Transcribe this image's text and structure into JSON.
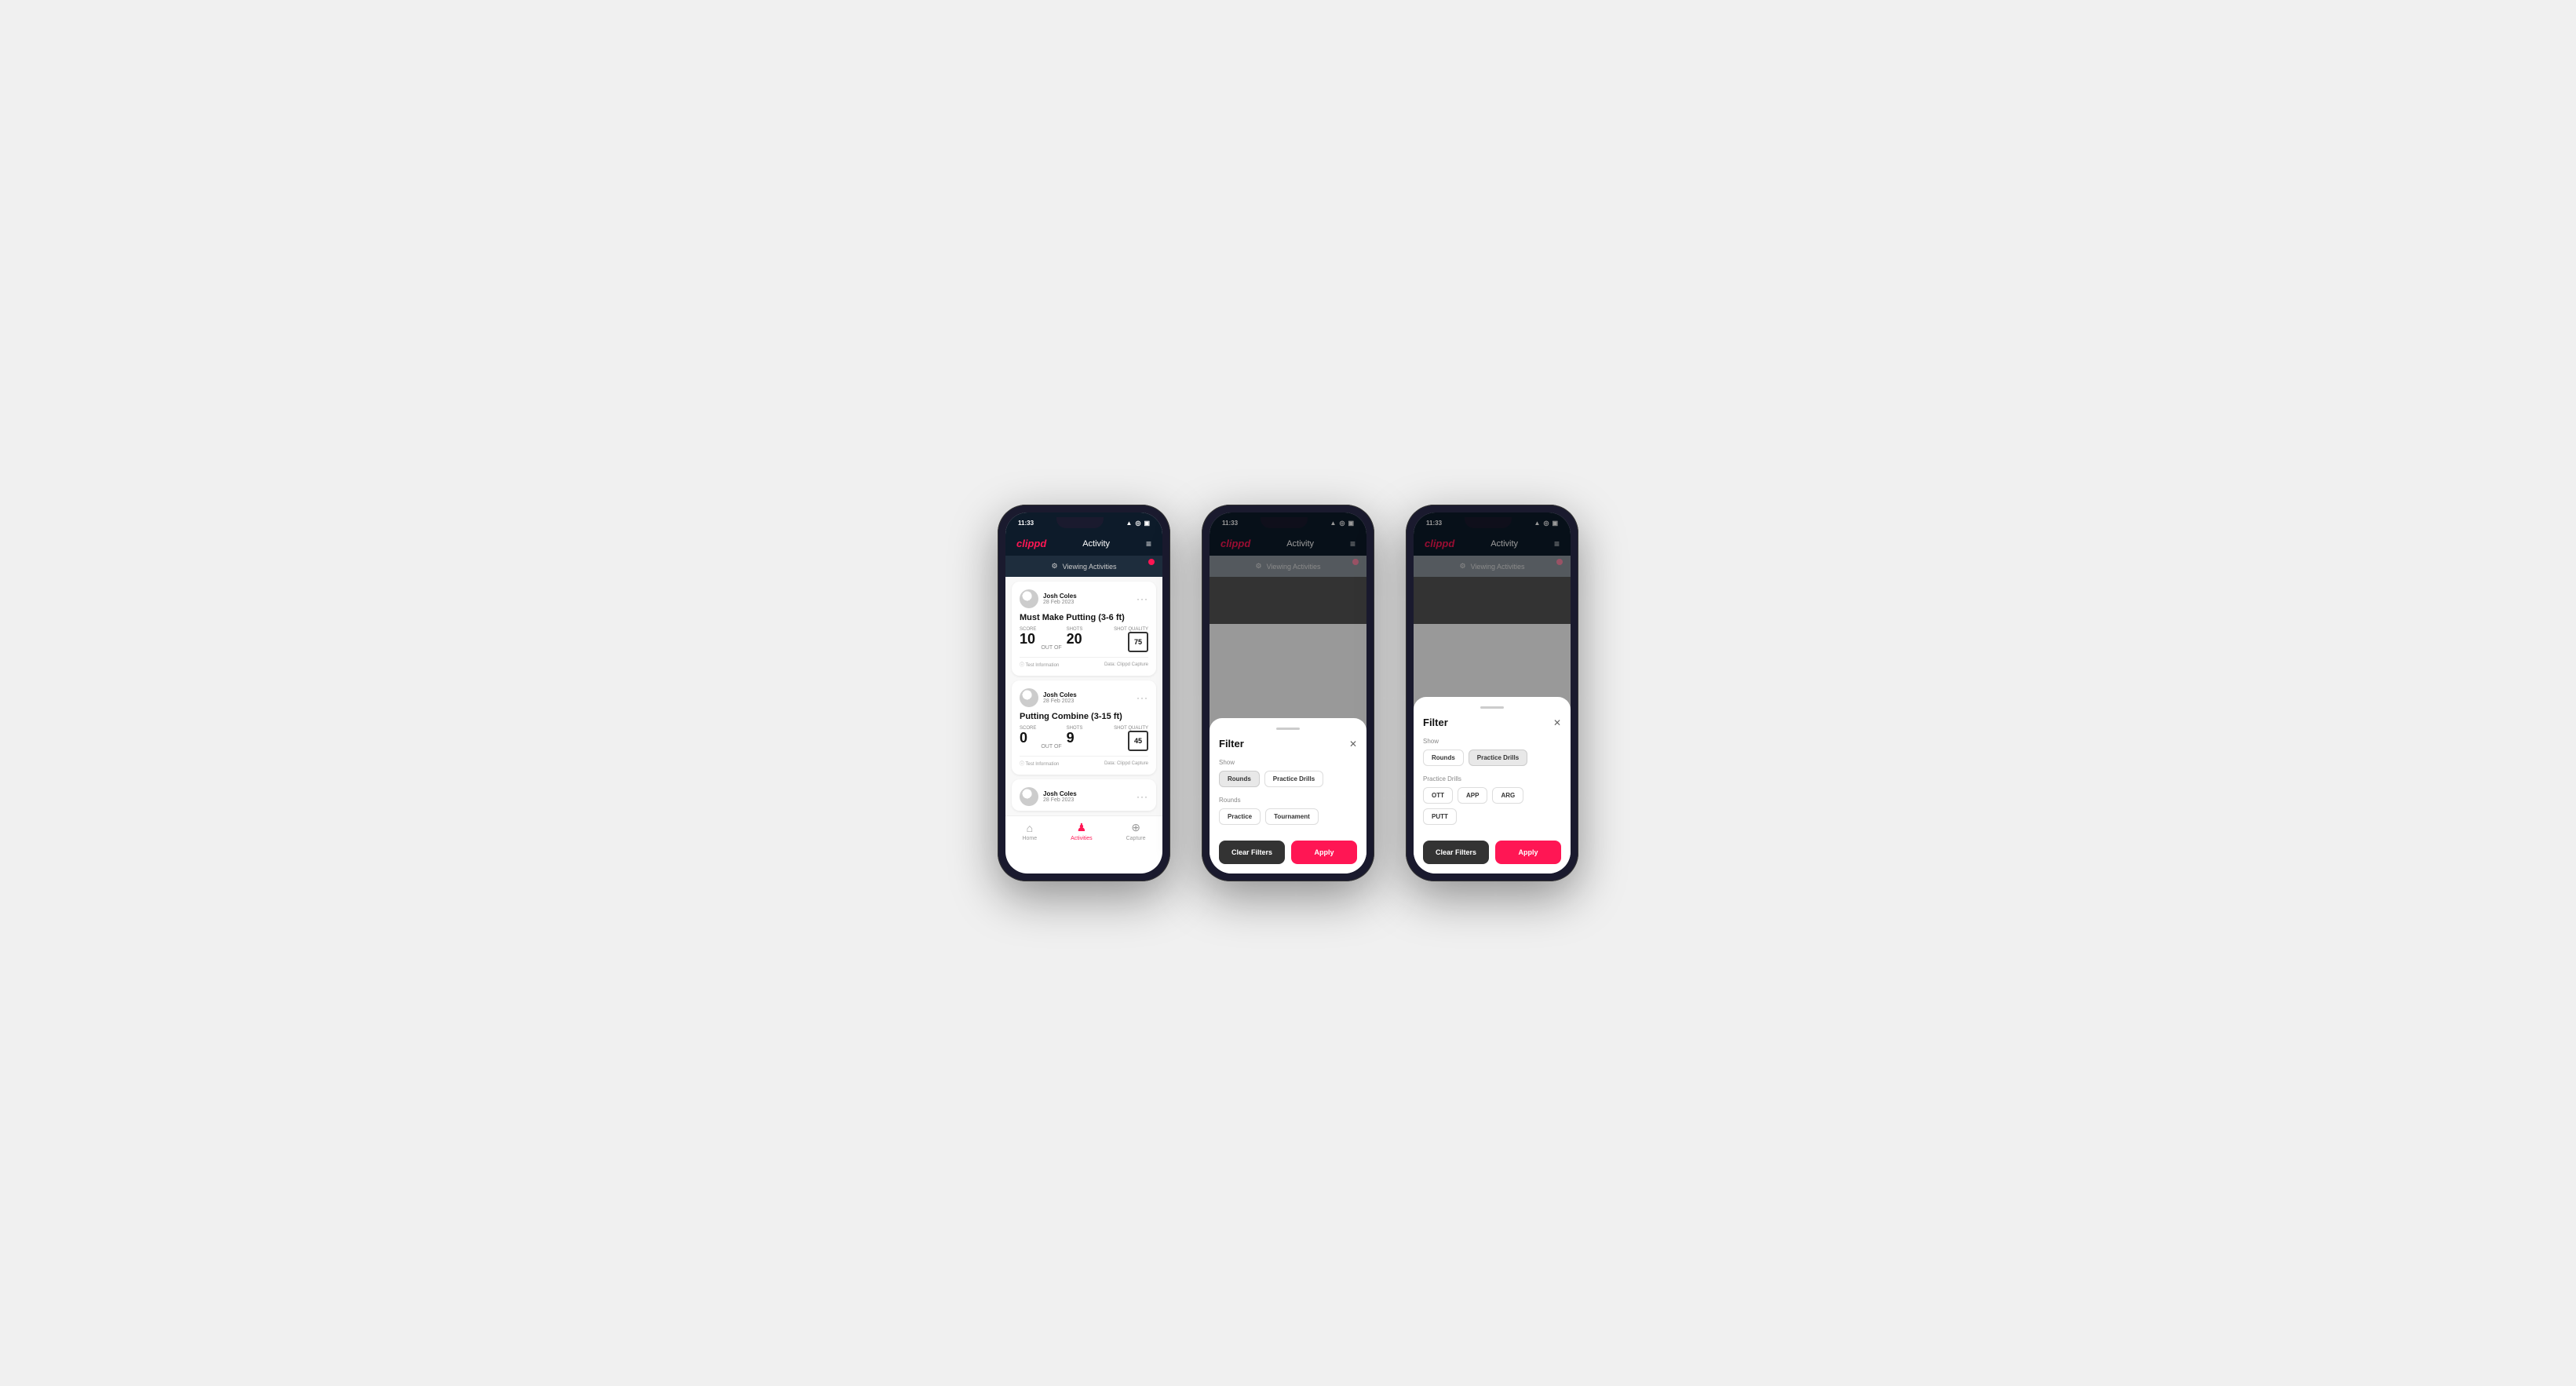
{
  "phones": [
    {
      "id": "phone1",
      "statusBar": {
        "time": "11:33",
        "icons": "▲ ◎ ▣"
      },
      "nav": {
        "logo": "clippd",
        "title": "Activity",
        "menuIcon": "≡"
      },
      "viewingBanner": {
        "icon": "⚙",
        "text": "Viewing Activities"
      },
      "activities": [
        {
          "user": "Josh Coles",
          "date": "28 Feb 2023",
          "title": "Must Make Putting (3-6 ft)",
          "scoreLabel": "Score",
          "score": "10",
          "outOf": "OUT OF",
          "shots": "20",
          "shotsLabel": "Shots",
          "shotQualityLabel": "Shot Quality",
          "shotQuality": "75",
          "footerLeft": "ⓘ Test Information",
          "footerRight": "Data: Clippd Capture"
        },
        {
          "user": "Josh Coles",
          "date": "28 Feb 2023",
          "title": "Putting Combine (3-15 ft)",
          "scoreLabel": "Score",
          "score": "0",
          "outOf": "OUT OF",
          "shots": "9",
          "shotsLabel": "Shots",
          "shotQualityLabel": "Shot Quality",
          "shotQuality": "45",
          "footerLeft": "ⓘ Test Information",
          "footerRight": "Data: Clippd Capture"
        },
        {
          "user": "Josh Coles",
          "date": "28 Feb 2023",
          "title": "",
          "scoreLabel": "",
          "score": "",
          "outOf": "",
          "shots": "",
          "shotsLabel": "",
          "shotQualityLabel": "",
          "shotQuality": "",
          "footerLeft": "",
          "footerRight": ""
        }
      ],
      "bottomNav": [
        {
          "icon": "⌂",
          "label": "Home",
          "active": false
        },
        {
          "icon": "♟",
          "label": "Activities",
          "active": true
        },
        {
          "icon": "⊕",
          "label": "Capture",
          "active": false
        }
      ],
      "hasModal": false
    },
    {
      "id": "phone2",
      "statusBar": {
        "time": "11:33",
        "icons": "▲ ◎ ▣"
      },
      "nav": {
        "logo": "clippd",
        "title": "Activity",
        "menuIcon": "≡"
      },
      "viewingBanner": {
        "icon": "⚙",
        "text": "Viewing Activities"
      },
      "hasModal": true,
      "modal": {
        "title": "Filter",
        "showLabel": "Show",
        "showButtons": [
          {
            "label": "Rounds",
            "active": true
          },
          {
            "label": "Practice Drills",
            "active": false
          }
        ],
        "roundsLabel": "Rounds",
        "roundButtons": [
          {
            "label": "Practice",
            "active": false
          },
          {
            "label": "Tournament",
            "active": false
          }
        ],
        "practiceLabel": null,
        "practiceButtons": [],
        "clearLabel": "Clear Filters",
        "applyLabel": "Apply"
      }
    },
    {
      "id": "phone3",
      "statusBar": {
        "time": "11:33",
        "icons": "▲ ◎ ▣"
      },
      "nav": {
        "logo": "clippd",
        "title": "Activity",
        "menuIcon": "≡"
      },
      "viewingBanner": {
        "icon": "⚙",
        "text": "Viewing Activities"
      },
      "hasModal": true,
      "modal": {
        "title": "Filter",
        "showLabel": "Show",
        "showButtons": [
          {
            "label": "Rounds",
            "active": false
          },
          {
            "label": "Practice Drills",
            "active": true
          }
        ],
        "roundsLabel": null,
        "roundButtons": [],
        "practiceLabel": "Practice Drills",
        "practiceButtons": [
          {
            "label": "OTT",
            "active": false
          },
          {
            "label": "APP",
            "active": false
          },
          {
            "label": "ARG",
            "active": false
          },
          {
            "label": "PUTT",
            "active": false
          }
        ],
        "clearLabel": "Clear Filters",
        "applyLabel": "Apply"
      }
    }
  ]
}
